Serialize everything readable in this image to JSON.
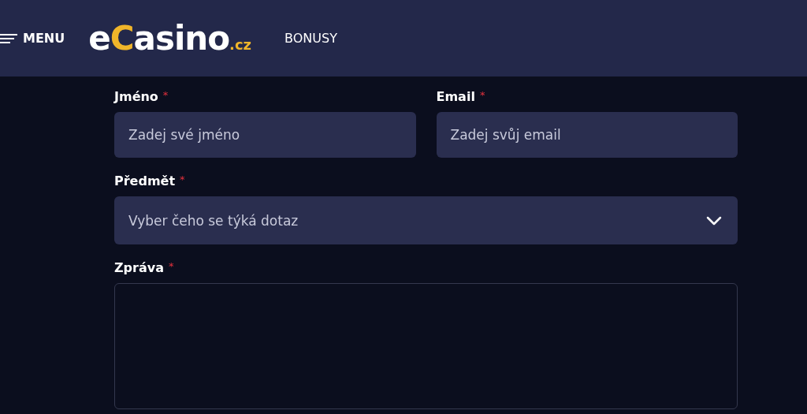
{
  "header": {
    "menu": {
      "label": "MENU"
    },
    "logo": {
      "parts": [
        {
          "text": "e",
          "accent": false,
          "small": false
        },
        {
          "text": "C",
          "accent": true,
          "small": false
        },
        {
          "text": "asino",
          "accent": false,
          "small": false
        },
        {
          "text": ".cz",
          "accent": true,
          "small": true
        }
      ]
    },
    "nav": [
      {
        "label": "BONUSY"
      }
    ]
  },
  "form": {
    "rows": [
      [
        {
          "kind": "text",
          "label": "Jméno",
          "required_mark": "*",
          "placeholder": "Zadej své jméno"
        },
        {
          "kind": "text",
          "label": "Email",
          "required_mark": "*",
          "placeholder": "Zadej svůj email"
        }
      ],
      [
        {
          "kind": "select",
          "label": "Předmět",
          "required_mark": "*",
          "placeholder": "Vyber čeho se týká dotaz"
        }
      ],
      [
        {
          "kind": "textarea",
          "label": "Zpráva",
          "required_mark": "*"
        }
      ]
    ]
  }
}
